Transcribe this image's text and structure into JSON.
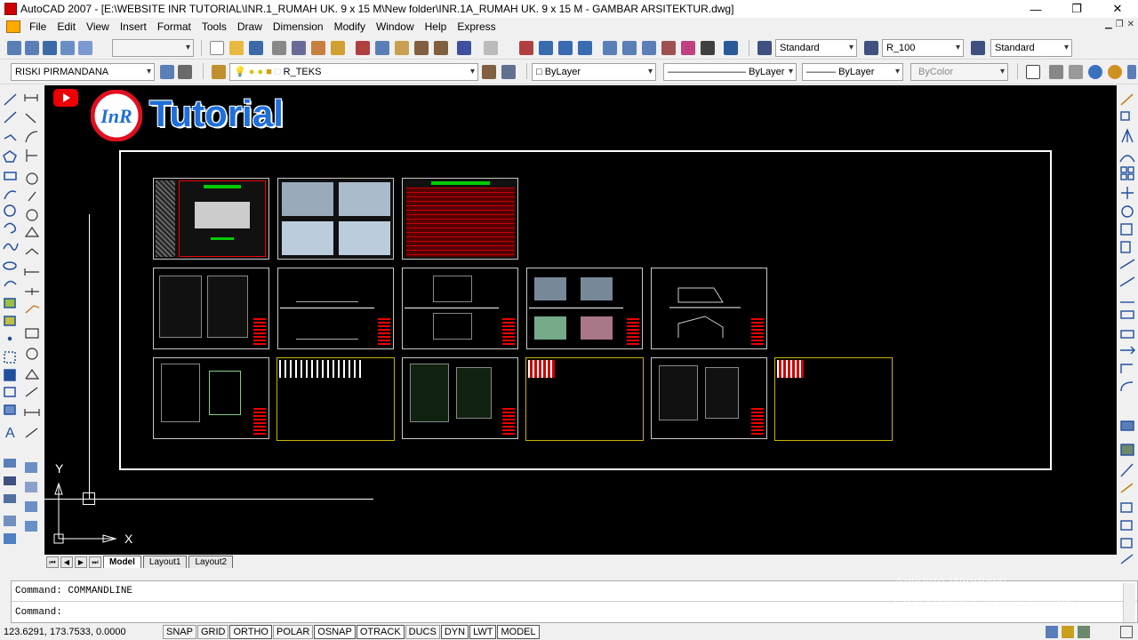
{
  "window": {
    "title": "AutoCAD 2007 - [E:\\WEBSITE INR TUTORIAL\\INR.1_RUMAH UK. 9 x 15 M\\New folder\\INR.1A_RUMAH UK. 9 x 15 M - GAMBAR ARSITEKTUR.dwg]",
    "minimize": "—",
    "restore": "❐",
    "close": "✕"
  },
  "menu": {
    "items": [
      "File",
      "Edit",
      "View",
      "Insert",
      "Format",
      "Tools",
      "Draw",
      "Dimension",
      "Modify",
      "Window",
      "Help",
      "Express"
    ]
  },
  "toolbar1": {
    "text_style": "Standard",
    "dim_style": "R_100",
    "table_style": "Standard"
  },
  "toolbar2": {
    "workspace": "RISKI PIRMANDANA",
    "layer": "R_TEKS",
    "color": "ByLayer",
    "linetype": "ByLayer",
    "lineweight": "ByLayer",
    "plotstyle": "ByColor"
  },
  "canvas": {
    "logo_text": "Tutorial",
    "logo_mark": "InR",
    "ucs_y": "Y",
    "ucs_x": "X"
  },
  "layout_tabs": {
    "tabs": [
      "Model",
      "Layout1",
      "Layout2"
    ],
    "active": "Model"
  },
  "command": {
    "history_line": "Command: COMMANDLINE",
    "prompt": "Command:"
  },
  "watermark": {
    "title": "Activate Windows",
    "subtitle": "Go to Settings to activate Windows."
  },
  "status": {
    "coordinates": "123.6291, 173.7533, 0.0000",
    "buttons": [
      "SNAP",
      "GRID",
      "ORTHO",
      "POLAR",
      "OSNAP",
      "OTRACK",
      "DUCS",
      "DYN",
      "LWT",
      "MODEL"
    ]
  },
  "colors": {
    "canvas_bg": "#000000",
    "sheet_border": "#c8c8c8",
    "yellow_border": "#c8b400",
    "logo_blue": "#1e6fd9",
    "logo_red": "#e01020"
  }
}
